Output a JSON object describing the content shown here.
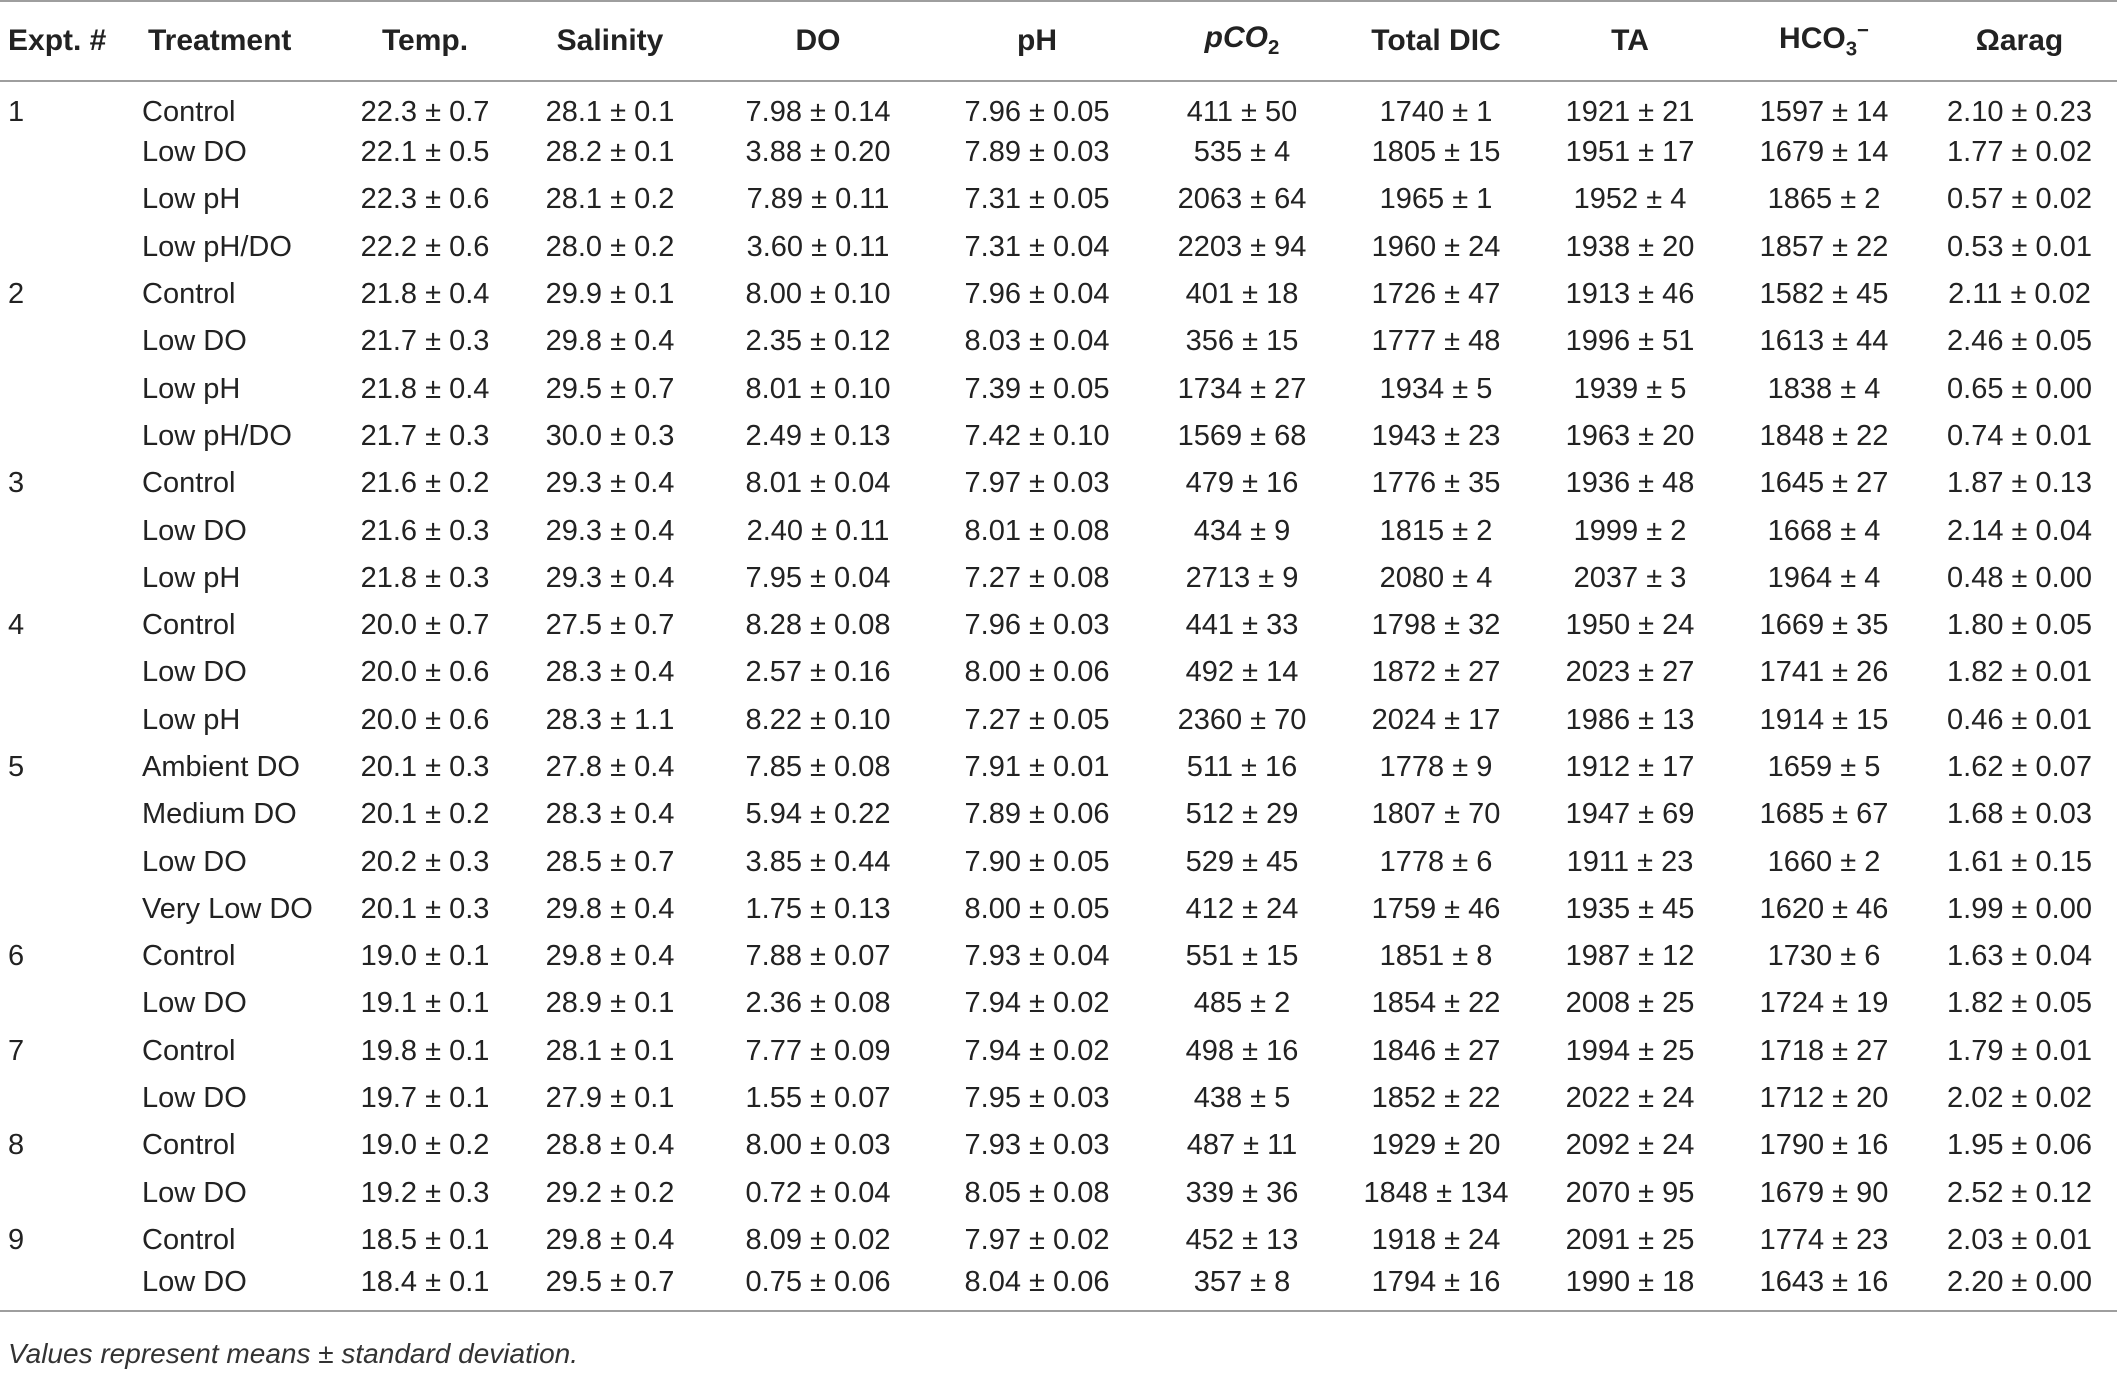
{
  "table": {
    "headers": {
      "expt": "Expt. #",
      "treatment": "Treatment",
      "temp": "Temp.",
      "salinity": "Salinity",
      "do": "DO",
      "ph": "pH",
      "pco2_main": "pCO",
      "pco2_sub": "2",
      "dic": "Total DIC",
      "ta": "TA",
      "hco3_main": "HCO",
      "hco3_sub": "3",
      "hco3_sup": "−",
      "omega": "Ωarag"
    },
    "rows": [
      {
        "expt": "1",
        "treatment": "Control",
        "temp": "22.3 ± 0.7",
        "salinity": "28.1 ± 0.1",
        "do": "7.98 ± 0.14",
        "ph": "7.96 ± 0.05",
        "pco2": "411 ± 50",
        "dic": "1740 ± 1",
        "ta": "1921 ± 21",
        "hco3": "1597 ± 14",
        "omega": "2.10 ± 0.23"
      },
      {
        "expt": "",
        "treatment": "Low DO",
        "temp": "22.1 ± 0.5",
        "salinity": "28.2 ± 0.1",
        "do": "3.88 ± 0.20",
        "ph": "7.89 ± 0.03",
        "pco2": "535 ± 4",
        "dic": "1805 ± 15",
        "ta": "1951 ± 17",
        "hco3": "1679 ± 14",
        "omega": "1.77 ± 0.02"
      },
      {
        "expt": "",
        "treatment": "Low pH",
        "temp": "22.3 ± 0.6",
        "salinity": "28.1 ± 0.2",
        "do": "7.89 ± 0.11",
        "ph": "7.31 ± 0.05",
        "pco2": "2063 ± 64",
        "dic": "1965 ± 1",
        "ta": "1952 ± 4",
        "hco3": "1865 ± 2",
        "omega": "0.57 ± 0.02"
      },
      {
        "expt": "",
        "treatment": "Low pH/DO",
        "temp": "22.2 ± 0.6",
        "salinity": "28.0 ± 0.2",
        "do": "3.60 ± 0.11",
        "ph": "7.31 ± 0.04",
        "pco2": "2203 ± 94",
        "dic": "1960 ± 24",
        "ta": "1938 ± 20",
        "hco3": "1857 ± 22",
        "omega": "0.53 ± 0.01"
      },
      {
        "expt": "2",
        "treatment": "Control",
        "temp": "21.8 ± 0.4",
        "salinity": "29.9 ± 0.1",
        "do": "8.00 ± 0.10",
        "ph": "7.96 ± 0.04",
        "pco2": "401 ± 18",
        "dic": "1726 ± 47",
        "ta": "1913 ± 46",
        "hco3": "1582 ± 45",
        "omega": "2.11 ± 0.02"
      },
      {
        "expt": "",
        "treatment": "Low DO",
        "temp": "21.7 ± 0.3",
        "salinity": "29.8 ± 0.4",
        "do": "2.35 ± 0.12",
        "ph": "8.03 ± 0.04",
        "pco2": "356 ± 15",
        "dic": "1777 ± 48",
        "ta": "1996 ± 51",
        "hco3": "1613 ± 44",
        "omega": "2.46 ± 0.05"
      },
      {
        "expt": "",
        "treatment": "Low pH",
        "temp": "21.8 ± 0.4",
        "salinity": "29.5 ± 0.7",
        "do": "8.01 ± 0.10",
        "ph": "7.39 ± 0.05",
        "pco2": "1734 ± 27",
        "dic": "1934 ± 5",
        "ta": "1939 ± 5",
        "hco3": "1838 ± 4",
        "omega": "0.65 ± 0.00"
      },
      {
        "expt": "",
        "treatment": "Low pH/DO",
        "temp": "21.7 ± 0.3",
        "salinity": "30.0 ± 0.3",
        "do": "2.49 ± 0.13",
        "ph": "7.42 ± 0.10",
        "pco2": "1569 ± 68",
        "dic": "1943 ± 23",
        "ta": "1963 ± 20",
        "hco3": "1848 ± 22",
        "omega": "0.74 ± 0.01"
      },
      {
        "expt": "3",
        "treatment": "Control",
        "temp": "21.6 ± 0.2",
        "salinity": "29.3 ± 0.4",
        "do": "8.01 ± 0.04",
        "ph": "7.97 ± 0.03",
        "pco2": "479 ± 16",
        "dic": "1776 ± 35",
        "ta": "1936 ± 48",
        "hco3": "1645 ± 27",
        "omega": "1.87 ± 0.13"
      },
      {
        "expt": "",
        "treatment": "Low DO",
        "temp": "21.6 ± 0.3",
        "salinity": "29.3 ± 0.4",
        "do": "2.40 ± 0.11",
        "ph": "8.01 ± 0.08",
        "pco2": "434 ± 9",
        "dic": "1815 ± 2",
        "ta": "1999 ± 2",
        "hco3": "1668 ± 4",
        "omega": "2.14 ± 0.04"
      },
      {
        "expt": "",
        "treatment": "Low pH",
        "temp": "21.8 ± 0.3",
        "salinity": "29.3 ± 0.4",
        "do": "7.95 ± 0.04",
        "ph": "7.27 ± 0.08",
        "pco2": "2713 ± 9",
        "dic": "2080 ± 4",
        "ta": "2037 ± 3",
        "hco3": "1964 ± 4",
        "omega": "0.48 ± 0.00"
      },
      {
        "expt": "4",
        "treatment": "Control",
        "temp": "20.0 ± 0.7",
        "salinity": "27.5 ± 0.7",
        "do": "8.28 ± 0.08",
        "ph": "7.96 ± 0.03",
        "pco2": "441 ± 33",
        "dic": "1798 ± 32",
        "ta": "1950 ± 24",
        "hco3": "1669 ± 35",
        "omega": "1.80 ± 0.05"
      },
      {
        "expt": "",
        "treatment": "Low DO",
        "temp": "20.0 ± 0.6",
        "salinity": "28.3 ± 0.4",
        "do": "2.57 ± 0.16",
        "ph": "8.00 ± 0.06",
        "pco2": "492 ± 14",
        "dic": "1872 ± 27",
        "ta": "2023 ± 27",
        "hco3": "1741 ± 26",
        "omega": "1.82 ± 0.01"
      },
      {
        "expt": "",
        "treatment": "Low pH",
        "temp": "20.0 ± 0.6",
        "salinity": "28.3 ± 1.1",
        "do": "8.22 ± 0.10",
        "ph": "7.27 ± 0.05",
        "pco2": "2360 ± 70",
        "dic": "2024 ± 17",
        "ta": "1986 ± 13",
        "hco3": "1914 ± 15",
        "omega": "0.46 ± 0.01"
      },
      {
        "expt": "5",
        "treatment": "Ambient DO",
        "temp": "20.1 ± 0.3",
        "salinity": "27.8 ± 0.4",
        "do": "7.85 ± 0.08",
        "ph": "7.91 ± 0.01",
        "pco2": "511 ± 16",
        "dic": "1778 ± 9",
        "ta": "1912 ± 17",
        "hco3": "1659 ± 5",
        "omega": "1.62 ± 0.07"
      },
      {
        "expt": "",
        "treatment": "Medium DO",
        "temp": "20.1 ± 0.2",
        "salinity": "28.3 ± 0.4",
        "do": "5.94 ± 0.22",
        "ph": "7.89 ± 0.06",
        "pco2": "512 ± 29",
        "dic": "1807 ± 70",
        "ta": "1947 ± 69",
        "hco3": "1685 ± 67",
        "omega": "1.68 ± 0.03"
      },
      {
        "expt": "",
        "treatment": "Low DO",
        "temp": "20.2 ± 0.3",
        "salinity": "28.5 ± 0.7",
        "do": "3.85 ± 0.44",
        "ph": "7.90 ± 0.05",
        "pco2": "529 ± 45",
        "dic": "1778 ± 6",
        "ta": "1911 ± 23",
        "hco3": "1660 ± 2",
        "omega": "1.61 ± 0.15"
      },
      {
        "expt": "",
        "treatment": "Very Low DO",
        "temp": "20.1 ± 0.3",
        "salinity": "29.8 ± 0.4",
        "do": "1.75 ± 0.13",
        "ph": "8.00 ± 0.05",
        "pco2": "412 ± 24",
        "dic": "1759 ± 46",
        "ta": "1935 ± 45",
        "hco3": "1620 ± 46",
        "omega": "1.99 ± 0.00"
      },
      {
        "expt": "6",
        "treatment": "Control",
        "temp": "19.0 ± 0.1",
        "salinity": "29.8 ± 0.4",
        "do": "7.88 ± 0.07",
        "ph": "7.93 ± 0.04",
        "pco2": "551 ± 15",
        "dic": "1851 ± 8",
        "ta": "1987 ± 12",
        "hco3": "1730 ± 6",
        "omega": "1.63 ± 0.04"
      },
      {
        "expt": "",
        "treatment": "Low DO",
        "temp": "19.1 ± 0.1",
        "salinity": "28.9 ± 0.1",
        "do": "2.36 ± 0.08",
        "ph": "7.94 ± 0.02",
        "pco2": "485 ± 2",
        "dic": "1854 ± 22",
        "ta": "2008 ± 25",
        "hco3": "1724 ± 19",
        "omega": "1.82 ± 0.05"
      },
      {
        "expt": "7",
        "treatment": "Control",
        "temp": "19.8 ± 0.1",
        "salinity": "28.1 ± 0.1",
        "do": "7.77 ± 0.09",
        "ph": "7.94 ± 0.02",
        "pco2": "498 ± 16",
        "dic": "1846 ± 27",
        "ta": "1994 ± 25",
        "hco3": "1718 ± 27",
        "omega": "1.79 ± 0.01"
      },
      {
        "expt": "",
        "treatment": "Low DO",
        "temp": "19.7 ± 0.1",
        "salinity": "27.9 ± 0.1",
        "do": "1.55 ± 0.07",
        "ph": "7.95 ± 0.03",
        "pco2": "438 ± 5",
        "dic": "1852 ± 22",
        "ta": "2022 ± 24",
        "hco3": "1712 ± 20",
        "omega": "2.02 ± 0.02"
      },
      {
        "expt": "8",
        "treatment": "Control",
        "temp": "19.0 ± 0.2",
        "salinity": "28.8 ± 0.4",
        "do": "8.00 ± 0.03",
        "ph": "7.93 ± 0.03",
        "pco2": "487 ± 11",
        "dic": "1929 ± 20",
        "ta": "2092 ± 24",
        "hco3": "1790 ± 16",
        "omega": "1.95 ± 0.06"
      },
      {
        "expt": "",
        "treatment": "Low DO",
        "temp": "19.2 ± 0.3",
        "salinity": "29.2 ± 0.2",
        "do": "0.72 ± 0.04",
        "ph": "8.05 ± 0.08",
        "pco2": "339 ± 36",
        "dic": "1848 ± 134",
        "ta": "2070 ± 95",
        "hco3": "1679 ± 90",
        "omega": "2.52 ± 0.12"
      },
      {
        "expt": "9",
        "treatment": "Control",
        "temp": "18.5 ± 0.1",
        "salinity": "29.8 ± 0.4",
        "do": "8.09 ± 0.02",
        "ph": "7.97 ± 0.02",
        "pco2": "452 ± 13",
        "dic": "1918 ± 24",
        "ta": "2091 ± 25",
        "hco3": "1774 ± 23",
        "omega": "2.03 ± 0.01"
      },
      {
        "expt": "",
        "treatment": "Low DO",
        "temp": "18.4 ± 0.1",
        "salinity": "29.5 ± 0.7",
        "do": "0.75 ± 0.06",
        "ph": "8.04 ± 0.06",
        "pco2": "357 ± 8",
        "dic": "1794 ± 16",
        "ta": "1990 ± 18",
        "hco3": "1643 ± 16",
        "omega": "2.20 ± 0.00"
      }
    ],
    "footnote": "Values represent means ± standard deviation."
  }
}
